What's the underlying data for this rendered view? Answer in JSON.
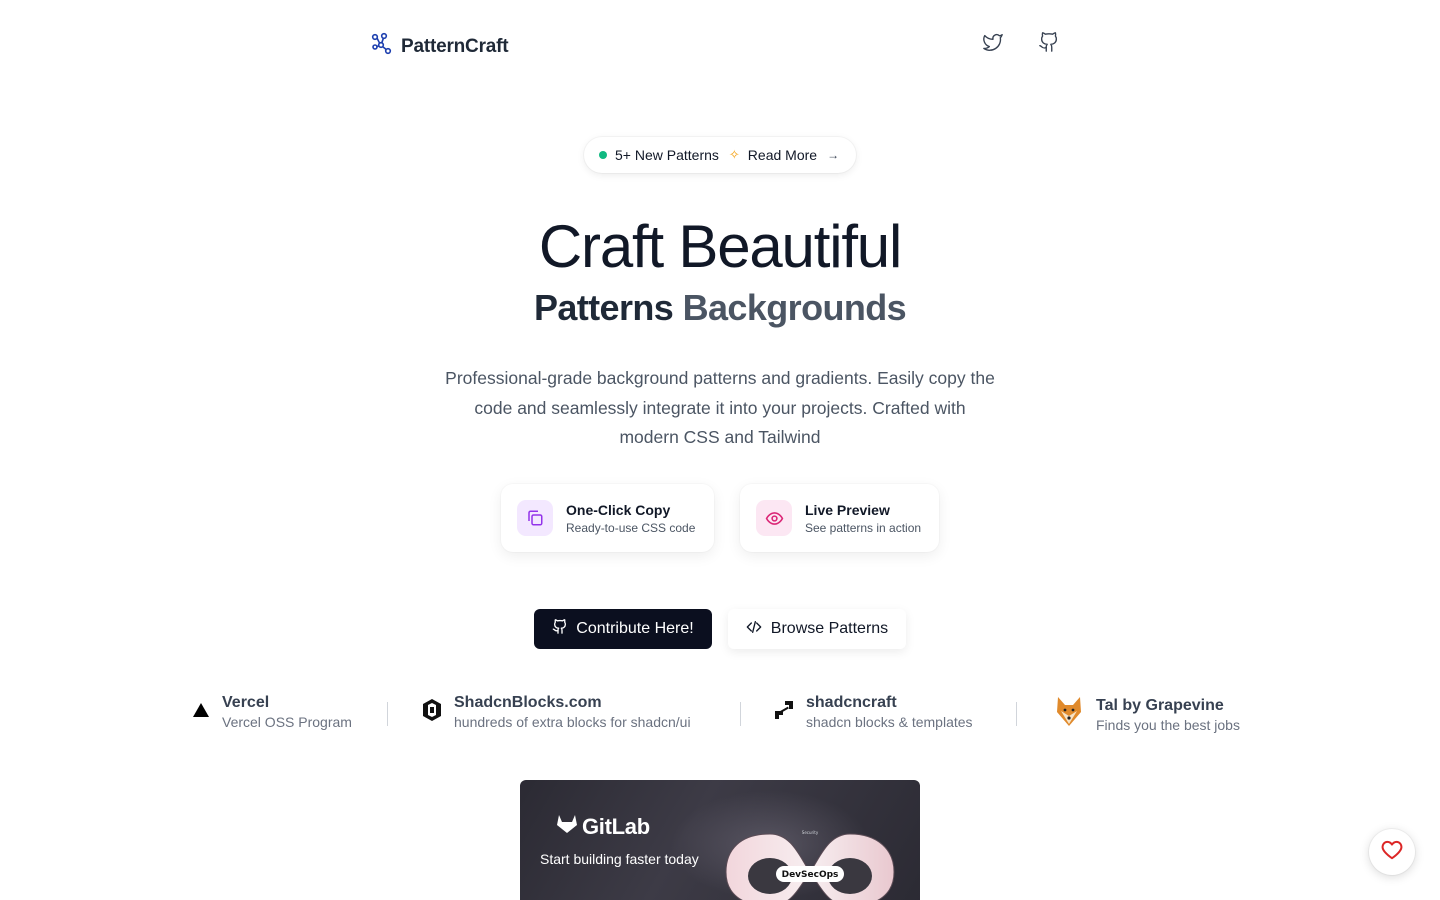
{
  "brand": {
    "name": "PatternCraft"
  },
  "nav": {
    "icons": [
      "twitter-icon",
      "github-icon"
    ]
  },
  "announcement": {
    "label": "5+ New Patterns",
    "link": "Read More",
    "dot_color": "#10b981"
  },
  "hero": {
    "title": "Craft Beautiful",
    "subtitle_a": "Patterns",
    "subtitle_b": "Backgrounds"
  },
  "description": "Professional-grade background patterns and gradients. Easily copy the code and seamlessly integrate it into your projects. Crafted with modern CSS and Tailwind",
  "features": [
    {
      "title": "One-Click Copy",
      "desc": "Ready-to-use CSS code",
      "icon": "copy-icon",
      "color": "#9333ea"
    },
    {
      "title": "Live Preview",
      "desc": "See patterns in action",
      "icon": "eye-icon",
      "color": "#db2777"
    }
  ],
  "buttons": {
    "primary": "Contribute Here!",
    "secondary": "Browse Patterns"
  },
  "sponsors": [
    {
      "name": "Vercel",
      "desc": "Vercel OSS Program"
    },
    {
      "name": "ShadcnBlocks.com",
      "desc": "hundreds of extra blocks for shadcn/ui"
    },
    {
      "name": "shadcncraft",
      "desc": "shadcn blocks & templates"
    },
    {
      "name": "Tal by Grapevine",
      "desc": "Finds you the best jobs"
    }
  ],
  "ad": {
    "brand": "GitLab",
    "text": "Start building faster today",
    "badge": "DevSecOps"
  },
  "colors": {
    "primary_button": "#0b0f1f",
    "heart": "#dc2626"
  }
}
